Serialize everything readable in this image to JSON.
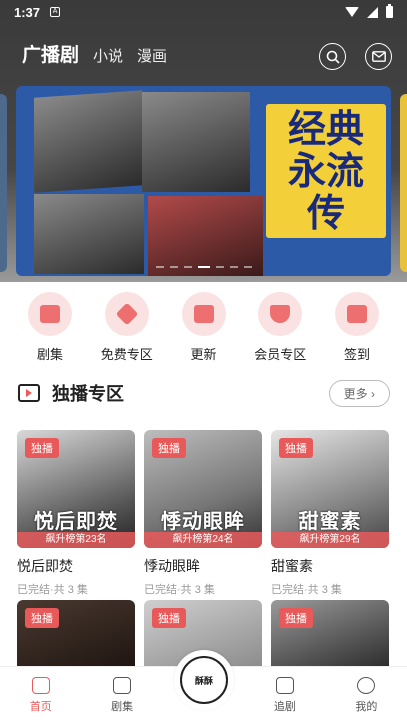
{
  "status": {
    "time": "1:37"
  },
  "nav": {
    "active": "广播剧",
    "items": [
      "小说",
      "漫画"
    ]
  },
  "banner": {
    "title_lines": [
      "经典",
      "永流",
      "传"
    ]
  },
  "quick_menu": [
    {
      "label": "剧集",
      "icon": "tv-icon"
    },
    {
      "label": "免费专区",
      "icon": "diamond-icon"
    },
    {
      "label": "更新",
      "icon": "list-icon"
    },
    {
      "label": "会员专区",
      "icon": "gem-icon"
    },
    {
      "label": "签到",
      "icon": "calendar-check-icon"
    }
  ],
  "section": {
    "title": "独播专区",
    "more": "更多 ›"
  },
  "cards": [
    {
      "tag": "独播",
      "cover_text": "悦后即焚",
      "rank": "飙升榜第23名",
      "title": "悦后即焚",
      "sub": "已完结·共 3 集"
    },
    {
      "tag": "独播",
      "cover_text": "悸动眼眸",
      "rank": "飙升榜第24名",
      "title": "悸动眼眸",
      "sub": "已完结·共 3 集"
    },
    {
      "tag": "独播",
      "cover_text": "甜蜜素",
      "rank": "飙升榜第29名",
      "title": "甜蜜素",
      "sub": "已完结·共 3 集"
    }
  ],
  "cards_row2": [
    {
      "tag": "独播"
    },
    {
      "tag": "独播"
    },
    {
      "tag": "独播"
    }
  ],
  "tabbar": {
    "home": "首页",
    "series": "剧集",
    "follow": "追剧",
    "mine": "我的",
    "logo": "酥酥"
  },
  "colors": {
    "accent": "#e85a5a"
  }
}
